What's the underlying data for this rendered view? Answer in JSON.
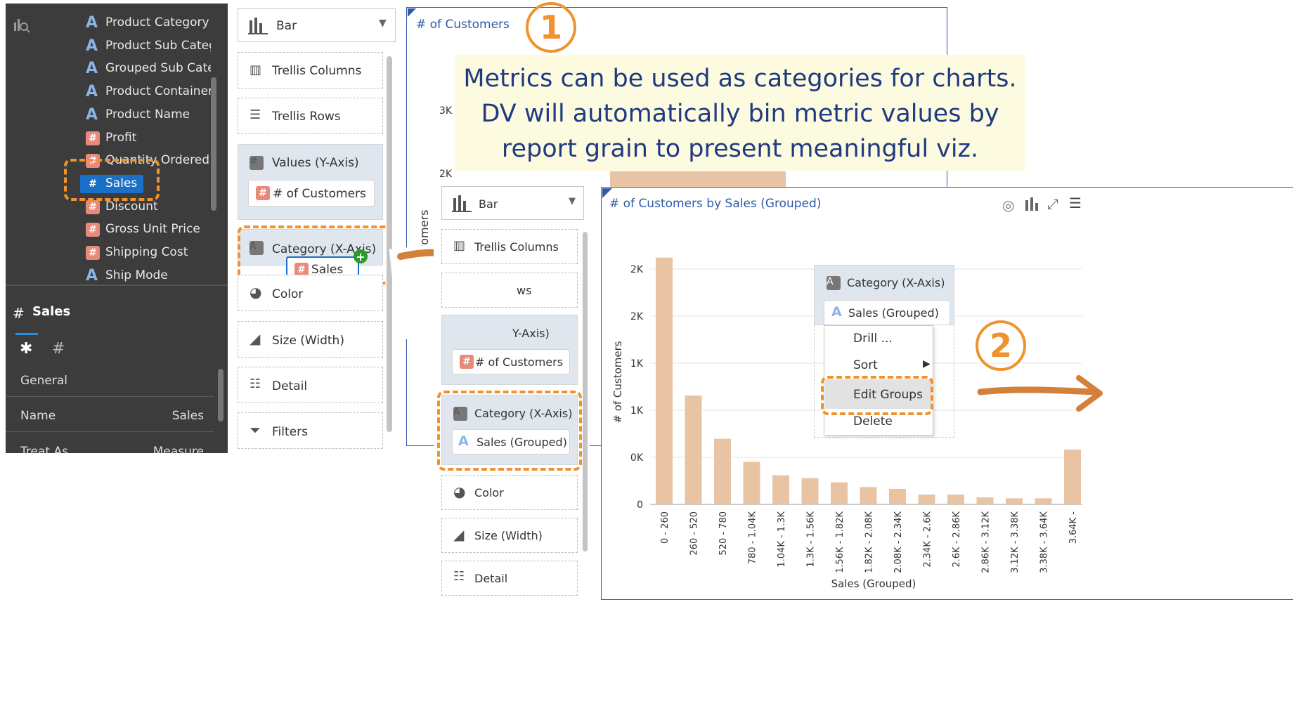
{
  "left_panel": {
    "fields": [
      {
        "type": "attr",
        "label": "Product Category"
      },
      {
        "type": "attr",
        "label": "Product Sub Catego"
      },
      {
        "type": "attr",
        "label": "Grouped Sub Categ"
      },
      {
        "type": "attr",
        "label": "Product Container"
      },
      {
        "type": "attr",
        "label": "Product Name"
      },
      {
        "type": "measure",
        "label": "Profit"
      },
      {
        "type": "measure",
        "label": "Quantity Ordered"
      },
      {
        "type": "measure",
        "label": "Sales"
      },
      {
        "type": "measure",
        "label": "Discount"
      },
      {
        "type": "measure",
        "label": "Gross Unit Price"
      },
      {
        "type": "measure",
        "label": "Shipping Cost"
      },
      {
        "type": "attr",
        "label": "Ship Mode"
      }
    ],
    "props_title": "Sales",
    "props_rows": [
      {
        "label": "General",
        "value": ""
      },
      {
        "label": "Name",
        "value": "Sales"
      },
      {
        "label": "Treat As",
        "value": "Measure"
      }
    ]
  },
  "grammar1": {
    "chart_type": "Bar",
    "trellis_columns": "Trellis Columns",
    "trellis_rows": "Trellis Rows",
    "values": "Values (Y-Axis)",
    "values_pill": "# of Customers",
    "category": "Category (X-Axis)",
    "drag_pill": "Sales",
    "color": "Color",
    "size": "Size (Width)",
    "detail": "Detail",
    "filters": "Filters"
  },
  "chart1": {
    "title": "# of Customers",
    "ytick_a": "3K",
    "ytick_b": "2K",
    "ylabel_fragment": "tomers"
  },
  "callout": {
    "number1": "1",
    "line1": "Metrics can be used as categories for charts.",
    "line2": "DV will automatically bin metric values by",
    "line3": "report grain to present meaningful viz.",
    "number2": "2"
  },
  "grammar2": {
    "chart_type": "Bar",
    "trellis_columns": "Trellis Columns",
    "trellis_rows_fragment": "ws",
    "values_fragment": "Y-Axis)",
    "values_pill": "# of Customers",
    "category": "Category (X-Axis)",
    "category_pill": "Sales (Grouped)",
    "color": "Color",
    "size": "Size (Width)",
    "detail": "Detail"
  },
  "chart2_popup": {
    "header": "Category (X-Axis)",
    "pill": "Sales (Grouped)",
    "menu": [
      "Drill ...",
      "Sort",
      "Edit Groups",
      "Delete"
    ]
  },
  "colors": {
    "dark_panel": "#3c3c3c",
    "highlight_orange": "#f0922e",
    "bar": "#e8c4a4",
    "callout_bg": "#fdfbdf",
    "callout_text": "#1f3a80",
    "chart_title": "#2e5aa6",
    "selected_blue": "#1a6fc6"
  },
  "chart_data": {
    "type": "bar",
    "title": "# of Customers by Sales (Grouped)",
    "xlabel": "Sales (Grouped)",
    "ylabel": "# of Customers",
    "ytick_labels": [
      "0",
      "0K",
      "1K",
      "1K",
      "2K",
      "2K"
    ],
    "categories": [
      "0 - 260",
      "260 - 520",
      "520 - 780",
      "780 - 1.04K",
      "1.04K - 1.3K",
      "1.3K - 1.56K",
      "1.56K - 1.82K",
      "1.82K - 2.08K",
      "2.08K - 2.34K",
      "2.34K - 2.6K",
      "2.6K - 2.86K",
      "2.86K - 3.12K",
      "3.12K - 3.38K",
      "3.38K - 3.64K",
      "3.64K -"
    ],
    "values": [
      2630,
      1160,
      700,
      455,
      310,
      280,
      235,
      185,
      165,
      105,
      105,
      75,
      65,
      65,
      585
    ],
    "ylim": [
      0,
      2650
    ],
    "grid": true
  }
}
